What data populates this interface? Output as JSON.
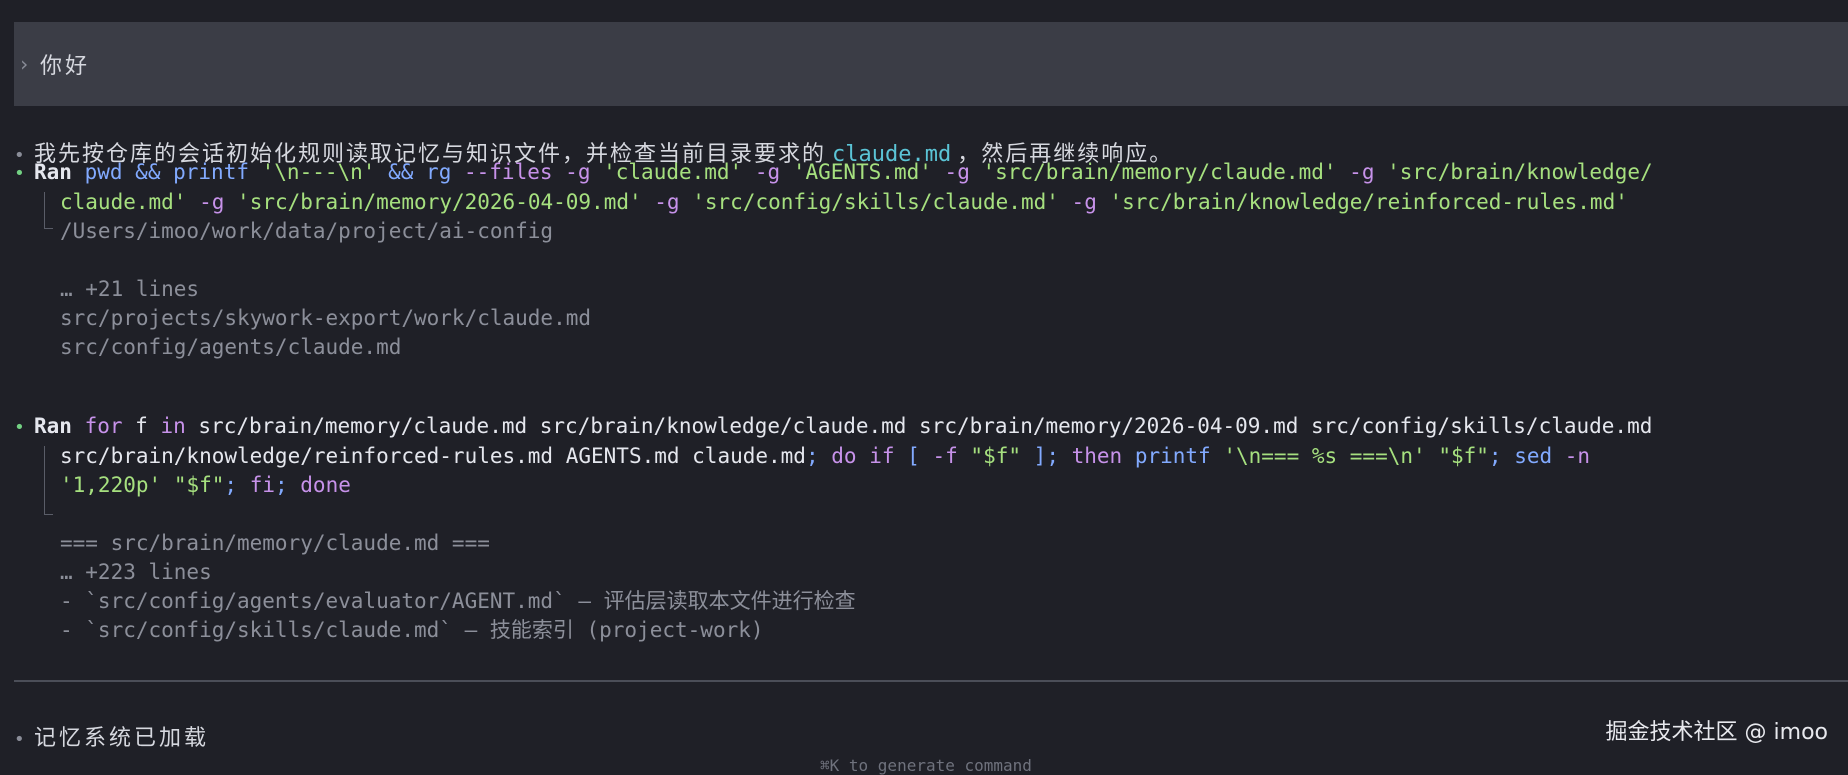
{
  "user_prompt": {
    "chevron": "›",
    "text": "你好"
  },
  "assistant_intro": {
    "before": "我先按仓库的会话初始化规则读取记忆与知识文件，并检查当前目录要求的",
    "code": "claude.md",
    "after": "，然后再继续响应。"
  },
  "commands": [
    {
      "label": "Ran",
      "lines": [
        [
          {
            "t": "pwd",
            "c": "fn"
          },
          {
            "t": " ",
            "c": "pl"
          },
          {
            "t": "&&",
            "c": "op"
          },
          {
            "t": " ",
            "c": "pl"
          },
          {
            "t": "printf",
            "c": "fn"
          },
          {
            "t": " ",
            "c": "pl"
          },
          {
            "t": "'\\n---\\n'",
            "c": "str"
          },
          {
            "t": " ",
            "c": "pl"
          },
          {
            "t": "&&",
            "c": "op"
          },
          {
            "t": " ",
            "c": "pl"
          },
          {
            "t": "rg",
            "c": "fn"
          },
          {
            "t": " ",
            "c": "pl"
          },
          {
            "t": "--files",
            "c": "flg"
          },
          {
            "t": " ",
            "c": "pl"
          },
          {
            "t": "-g",
            "c": "flg"
          },
          {
            "t": " ",
            "c": "pl"
          },
          {
            "t": "'claude.md'",
            "c": "str"
          },
          {
            "t": " ",
            "c": "pl"
          },
          {
            "t": "-g",
            "c": "flg"
          },
          {
            "t": " ",
            "c": "pl"
          },
          {
            "t": "'AGENTS.md'",
            "c": "str"
          },
          {
            "t": " ",
            "c": "pl"
          },
          {
            "t": "-g",
            "c": "flg"
          },
          {
            "t": " ",
            "c": "pl"
          },
          {
            "t": "'src/brain/memory/claude.md'",
            "c": "str"
          },
          {
            "t": " ",
            "c": "pl"
          },
          {
            "t": "-g",
            "c": "flg"
          },
          {
            "t": " ",
            "c": "pl"
          },
          {
            "t": "'src/brain/knowledge/",
            "c": "str"
          }
        ],
        [
          {
            "t": "claude.md'",
            "c": "str"
          },
          {
            "t": " ",
            "c": "pl"
          },
          {
            "t": "-g",
            "c": "flg"
          },
          {
            "t": " ",
            "c": "pl"
          },
          {
            "t": "'src/brain/memory/2026-04-09.md'",
            "c": "str"
          },
          {
            "t": " ",
            "c": "pl"
          },
          {
            "t": "-g",
            "c": "flg"
          },
          {
            "t": " ",
            "c": "pl"
          },
          {
            "t": "'src/config/skills/claude.md'",
            "c": "str"
          },
          {
            "t": " ",
            "c": "pl"
          },
          {
            "t": "-g",
            "c": "flg"
          },
          {
            "t": " ",
            "c": "pl"
          },
          {
            "t": "'src/brain/knowledge/reinforced-rules.md'",
            "c": "str"
          }
        ]
      ],
      "output": [
        "/Users/imoo/work/data/project/ai-config",
        "",
        "… +21 lines",
        "src/projects/skywork-export/work/claude.md",
        "src/config/agents/claude.md"
      ]
    },
    {
      "label": "Ran",
      "lines": [
        [
          {
            "t": "for",
            "c": "kw"
          },
          {
            "t": " f ",
            "c": "pl"
          },
          {
            "t": "in",
            "c": "kw"
          },
          {
            "t": " ",
            "c": "pl"
          },
          {
            "t": "src/brain/memory/claude.md src/brain/knowledge/claude.md src/brain/memory/2026-04-09.md src/config/skills/claude.md",
            "c": "pl"
          }
        ],
        [
          {
            "t": "src/brain/knowledge/reinforced-rules.md AGENTS.md claude.md",
            "c": "pl"
          },
          {
            "t": "; ",
            "c": "op"
          },
          {
            "t": "do",
            "c": "kw"
          },
          {
            "t": " ",
            "c": "pl"
          },
          {
            "t": "if",
            "c": "kw"
          },
          {
            "t": " ",
            "c": "pl"
          },
          {
            "t": "[",
            "c": "op"
          },
          {
            "t": " ",
            "c": "pl"
          },
          {
            "t": "-f",
            "c": "flg"
          },
          {
            "t": " ",
            "c": "pl"
          },
          {
            "t": "\"$f\"",
            "c": "str"
          },
          {
            "t": " ",
            "c": "pl"
          },
          {
            "t": "]",
            "c": "op"
          },
          {
            "t": "; ",
            "c": "op"
          },
          {
            "t": "then",
            "c": "kw"
          },
          {
            "t": " ",
            "c": "pl"
          },
          {
            "t": "printf",
            "c": "fn"
          },
          {
            "t": " ",
            "c": "pl"
          },
          {
            "t": "'\\n=== %s ===\\n'",
            "c": "str"
          },
          {
            "t": " ",
            "c": "pl"
          },
          {
            "t": "\"$f\"",
            "c": "str"
          },
          {
            "t": "; ",
            "c": "op"
          },
          {
            "t": "sed",
            "c": "fn"
          },
          {
            "t": " ",
            "c": "pl"
          },
          {
            "t": "-n",
            "c": "flg"
          }
        ],
        [
          {
            "t": "'1,220p'",
            "c": "str"
          },
          {
            "t": " ",
            "c": "pl"
          },
          {
            "t": "\"$f\"",
            "c": "str"
          },
          {
            "t": "; ",
            "c": "op"
          },
          {
            "t": "fi",
            "c": "kw"
          },
          {
            "t": "; ",
            "c": "op"
          },
          {
            "t": "done",
            "c": "kw"
          }
        ]
      ],
      "output": [
        "=== src/brain/memory/claude.md ===",
        "… +223 lines",
        "- `src/config/agents/evaluator/AGENT.md` — 评估层读取本文件进行检查",
        "- `src/config/skills/claude.md` — 技能索引 (project-work)"
      ]
    }
  ],
  "final_message": "记忆系统已加载",
  "watermark": "掘金技术社区 @ imoo",
  "hint": "⌘K to generate command",
  "colors": {
    "background": "#1f2027",
    "prompt_bg": "#3b3d46",
    "green_bullet": "#73d183",
    "code_accent": "#5bc4d6",
    "string": "#a6e07f",
    "keyword": "#c792ea",
    "function": "#82aaff"
  }
}
